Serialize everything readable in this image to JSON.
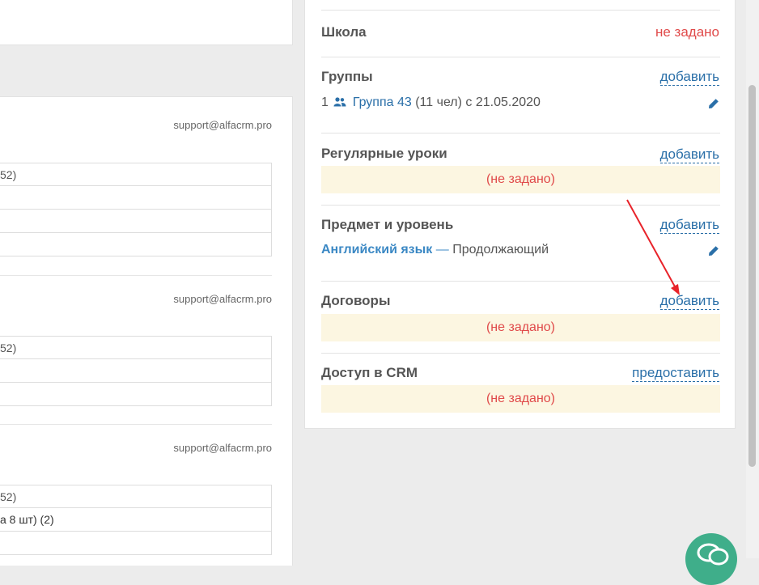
{
  "left": {
    "blocks": [
      {
        "email": "support@alfacrm.pro",
        "rows": [
          "52)",
          "",
          "",
          ""
        ]
      },
      {
        "email": "support@alfacrm.pro",
        "rows": [
          "52)",
          "",
          ""
        ]
      },
      {
        "email": "support@alfacrm.pro",
        "rows": [
          "52)",
          "а 8 шт) (2)",
          ""
        ]
      }
    ]
  },
  "right": {
    "school": {
      "label": "Школа",
      "value": "не задано"
    },
    "groups": {
      "label": "Группы",
      "action": "добавить",
      "item": {
        "index": "1",
        "name": "Группа 43",
        "count": "(11 чел)",
        "since": "с 21.05.2020"
      }
    },
    "regular_lessons": {
      "label": "Регулярные уроки",
      "action": "добавить",
      "empty": "(не задано)"
    },
    "subject_level": {
      "label": "Предмет и уровень",
      "action": "добавить",
      "subject": "Английский язык",
      "dash": "—",
      "level": "Продолжающий"
    },
    "contracts": {
      "label": "Договоры",
      "action": "добавить",
      "empty": "(не задано)"
    },
    "crm_access": {
      "label": "Доступ в CRM",
      "action": "предоставить",
      "empty": "(не задано)"
    }
  },
  "icons": {
    "edit": "pencil-icon",
    "people": "people-icon",
    "chat": "chat-bubble-icon"
  },
  "colors": {
    "link": "#2a6fa8",
    "not_set": "#e04a4a",
    "empty_bg": "#fcf6e1",
    "chat": "#3fae8a",
    "arrow": "#e8232a"
  }
}
